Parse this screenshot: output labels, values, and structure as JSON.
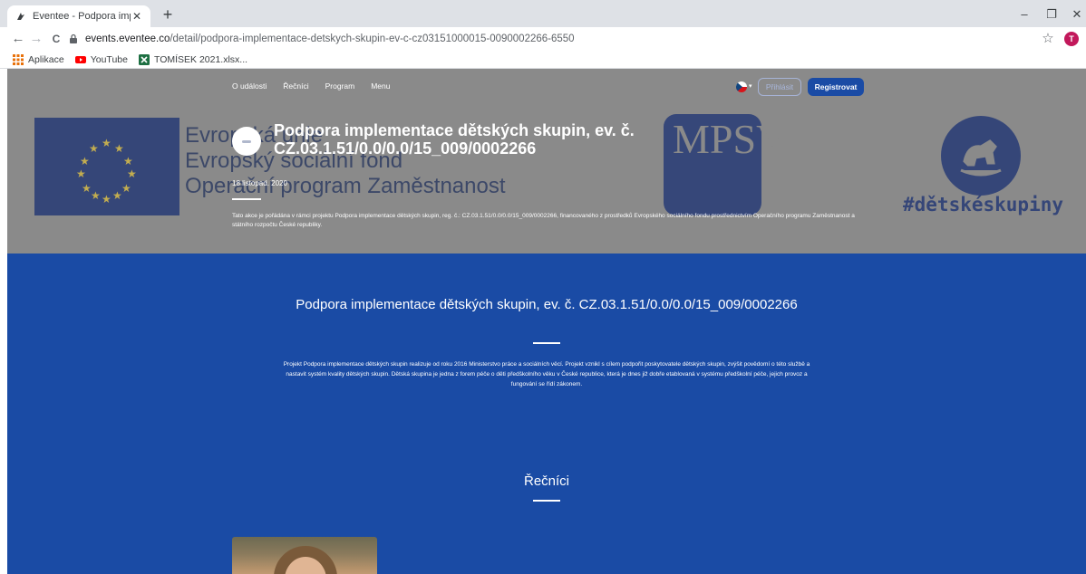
{
  "browser": {
    "tab": {
      "title": "Eventee - Podpora implementac",
      "favicon": "eventee-icon"
    },
    "window_controls": {
      "minimize": "–",
      "restore": "❐",
      "close": "✕"
    },
    "nav": {
      "back": "←",
      "forward": "→",
      "reload": "C"
    },
    "address": {
      "host": "events.eventee.co",
      "path": "/detail/podpora-implementace-detskych-skupin-ev-c-cz03151000015-0090002266-6550"
    },
    "profile_initial": "T",
    "bookmarks": [
      {
        "label": "Aplikace",
        "icon": "apps-grid-icon"
      },
      {
        "label": "YouTube",
        "icon": "youtube-icon"
      },
      {
        "label": "TOMÍSEK 2021.xlsx...",
        "icon": "excel-icon"
      }
    ]
  },
  "hero_background": {
    "esf_lines": [
      "Evropská unie",
      "Evropský sociální fond",
      "Operační program Zaměstnanost"
    ],
    "mpsv_letters": "MPSV",
    "hashtag": "#dětskéskupiny"
  },
  "site_nav": {
    "items": [
      "O události",
      "Řečníci",
      "Program",
      "Menu"
    ],
    "login": "Přihlásit",
    "register": "Registrovat"
  },
  "hero": {
    "title": "Podpora implementace dětských skupin, ev. č. CZ.03.1.51/0.0/0.0/15_009/0002266",
    "date": "18 listopad. 2020",
    "description": "Tato akce je pořádána v rámci projektu Podpora implementace dětských skupin, reg. č.: CZ.03.1.51/0.0/0.0/15_009/0002266, financovaného z prostředků Evropského sociálního fondu prostřednictvím Operačního programu Zaměstnanost a státního rozpočtu České republiky."
  },
  "about": {
    "title": "Podpora implementace dětských skupin, ev. č. CZ.03.1.51/0.0/0.0/15_009/0002266",
    "description": "Projekt Podpora implementace dětských skupin realizuje od roku 2016 Ministerstvo práce a sociálních věcí. Projekt vznikl s cílem podpořit poskytovatele dětských skupin, zvýšit povědomí o této službě a nastavit systém kvality dětských skupin. Dětská skupina je jedna z forem péče o děti předškolního věku v České republice, která je dnes již dobře etablovaná v systému předškolní péče, jejich provoz a fungování se řídí zákonem."
  },
  "speakers": {
    "title": "Řečníci"
  },
  "colors": {
    "brand_blue": "#1a4ba5",
    "hero_overlay": "#8a8a8a",
    "logo_navy": "#2c3f77"
  }
}
